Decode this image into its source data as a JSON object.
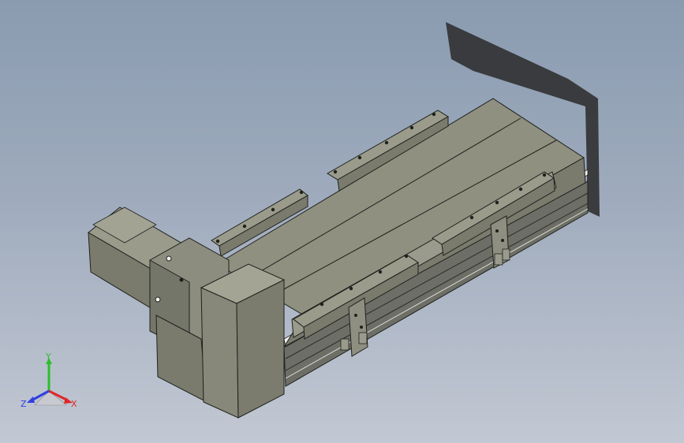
{
  "viewport": {
    "background_top": "#8a9bb0",
    "background_bottom": "#c2c8d3"
  },
  "model": {
    "body_color": "#8c8d7f",
    "edge_color": "#1f211d",
    "shadow_color": "#3a3b3d",
    "highlight_color": "#f2f2ee"
  },
  "triad": {
    "x_label": "X",
    "y_label": "Y",
    "z_label": "Z",
    "x_color": "#e0262a",
    "y_color": "#2ac02a",
    "z_color": "#2f3fe0"
  }
}
